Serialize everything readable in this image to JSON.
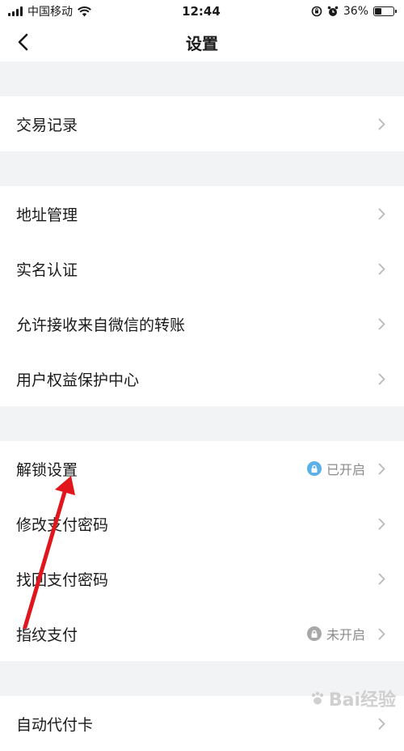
{
  "status_bar": {
    "carrier": "中国移动",
    "time": "12:44",
    "battery": "36%",
    "battery_level": 0.36
  },
  "nav": {
    "title": "设置"
  },
  "groups": [
    {
      "rows": [
        {
          "label": "交易记录"
        }
      ]
    },
    {
      "rows": [
        {
          "label": "地址管理"
        },
        {
          "label": "实名认证"
        },
        {
          "label": "允许接收来自微信的转账"
        },
        {
          "label": "用户权益保护中心"
        }
      ]
    },
    {
      "rows": [
        {
          "label": "解锁设置",
          "status": "已开启",
          "lock_color": "#5bb0e8"
        },
        {
          "label": "修改支付密码"
        },
        {
          "label": "找回支付密码"
        },
        {
          "label": "指纹支付",
          "status": "未开启",
          "lock_color": "#a8a8a8"
        }
      ]
    },
    {
      "rows": [
        {
          "label": "自动代付卡"
        }
      ]
    }
  ],
  "watermark": {
    "text": "Bai经验"
  },
  "colors": {
    "background": "#f2f3f5",
    "annotation_arrow": "#e0161c"
  }
}
